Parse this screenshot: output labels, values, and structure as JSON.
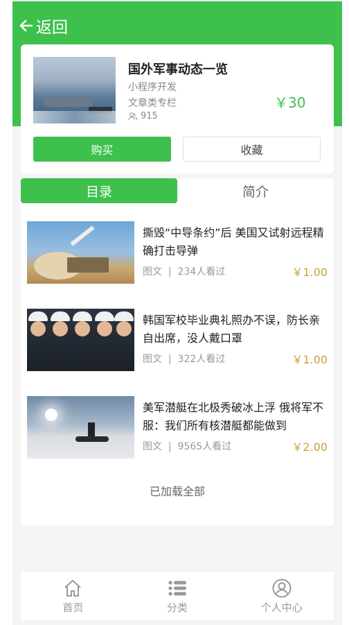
{
  "header": {
    "back_label": "返回"
  },
  "product": {
    "title": "国外军事动态一览",
    "author": "小程序开发",
    "category": "文章类专栏",
    "views": "915",
    "price": "￥30",
    "buy_label": "购买",
    "fav_label": "收藏"
  },
  "tabs": [
    {
      "label": "目录",
      "active": true
    },
    {
      "label": "简介",
      "active": false
    }
  ],
  "articles": [
    {
      "title": "撕毁“中导条约”后 美国又试射远程精确打击导弹",
      "type": "图文",
      "views": "234人看过",
      "price": "￥1.00"
    },
    {
      "title": "韩国军校毕业典礼照办不误，防长亲自出席，没人戴口罩",
      "type": "图文",
      "views": "322人看过",
      "price": "￥1.00"
    },
    {
      "title": "美军潜艇在北极秀破冰上浮 俄将军不服：我们所有核潜艇都能做到",
      "type": "图文",
      "views": "9565人看过",
      "price": "￥2.00"
    }
  ],
  "meta_separator": "|",
  "loaded_text": "已加载全部",
  "tabbar": [
    {
      "label": "首页",
      "icon": "home-icon"
    },
    {
      "label": "分类",
      "icon": "list-icon"
    },
    {
      "label": "个人中心",
      "icon": "user-icon"
    }
  ],
  "colors": {
    "primary": "#3ec04d",
    "price_gold": "#c9a13b"
  }
}
